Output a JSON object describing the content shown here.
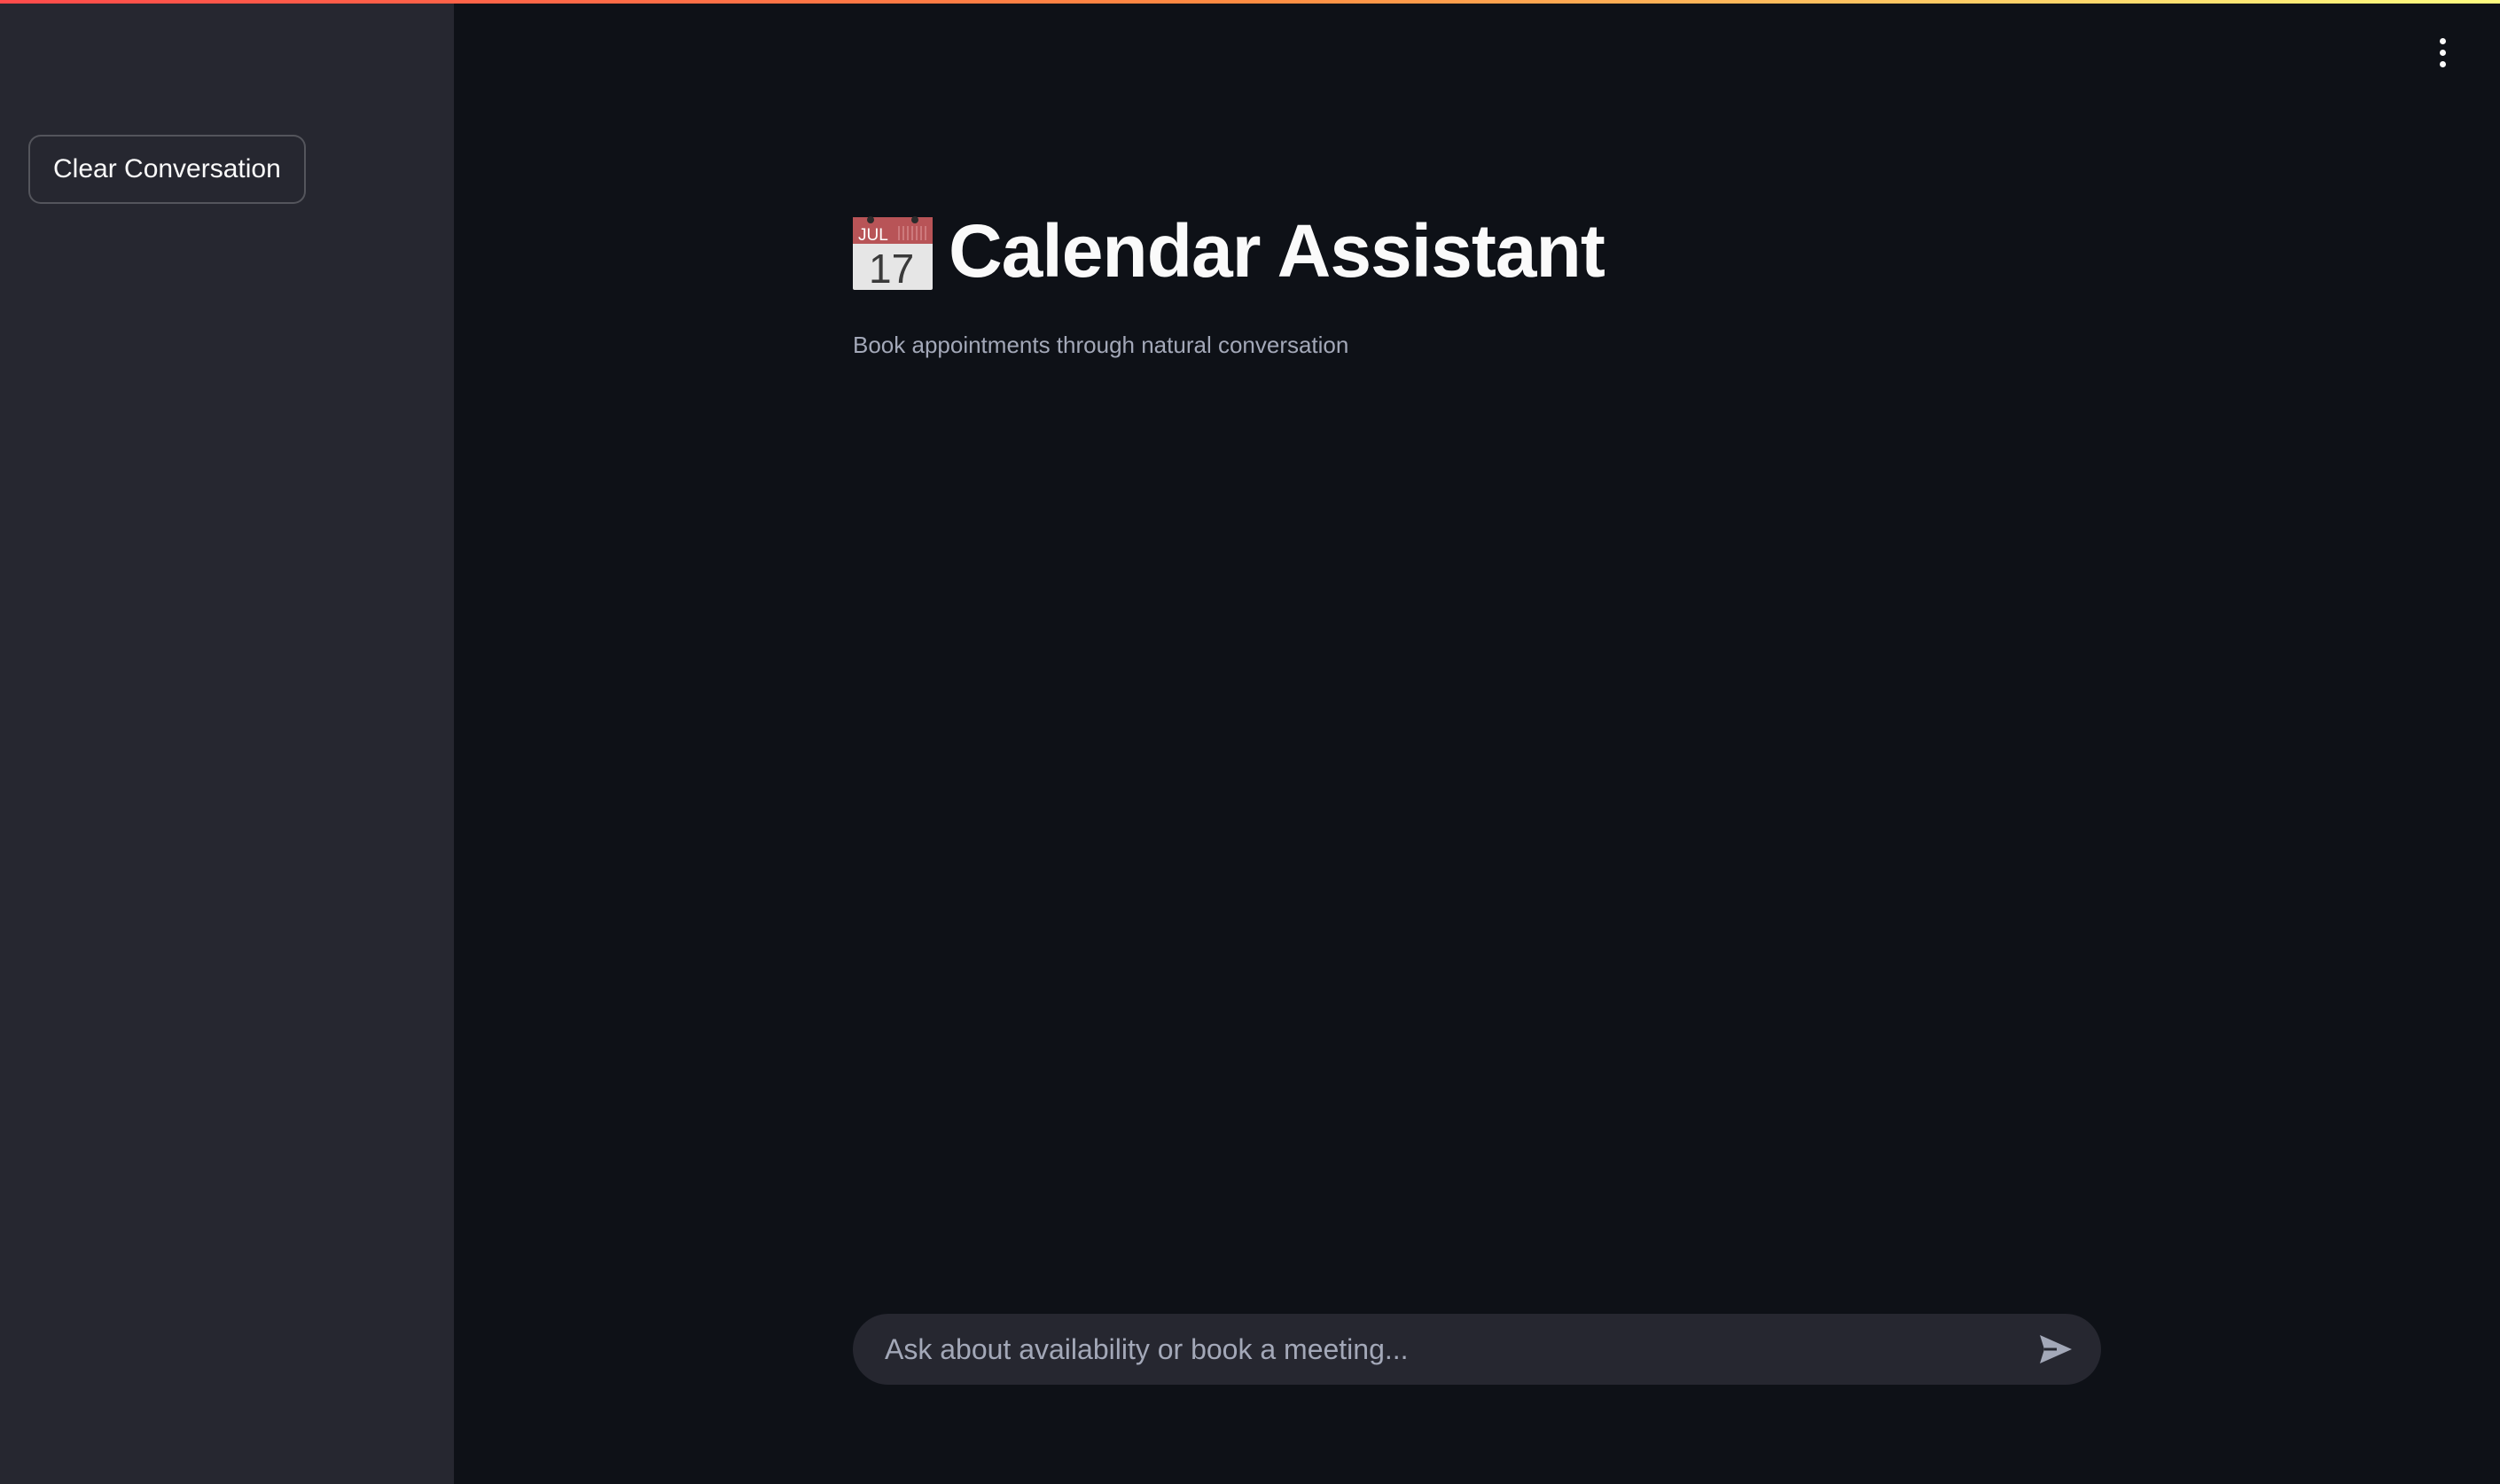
{
  "colors": {
    "background": "#0e1117",
    "sidebar": "#262730",
    "text": "#fafafa",
    "muted_text": "#a3a8b8",
    "accent_gradient": [
      "#ff4b4b",
      "#fffd80"
    ]
  },
  "sidebar": {
    "clear_button_label": "Clear Conversation"
  },
  "header": {
    "menu_icon": "kebab-menu-icon"
  },
  "main": {
    "title_icon": "calendar-icon",
    "calendar_icon_month": "JUL",
    "calendar_icon_day": "17",
    "title": "Calendar Assistant",
    "subtitle": "Book appointments through natural conversation"
  },
  "chat": {
    "input_placeholder": "Ask about availability or book a meeting...",
    "input_value": "",
    "send_icon": "send-icon"
  }
}
